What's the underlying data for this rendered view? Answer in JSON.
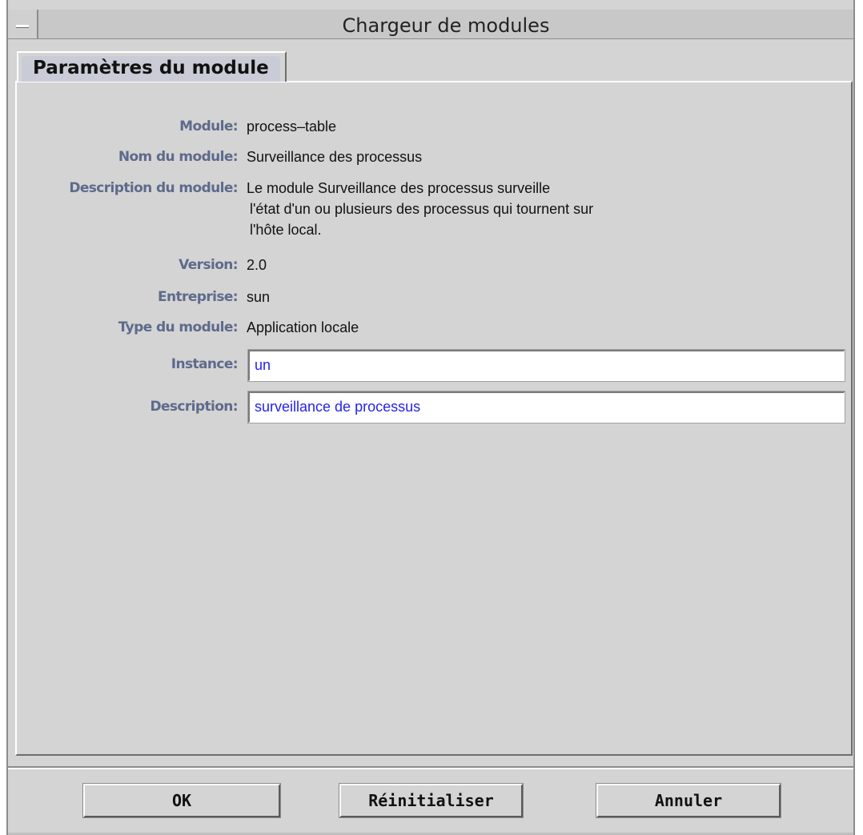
{
  "window": {
    "title": "Chargeur de modules"
  },
  "tabs": [
    {
      "label": "Paramètres du module",
      "selected": true
    }
  ],
  "fields": {
    "module": {
      "label": "Module:",
      "value": "process–table"
    },
    "module_name": {
      "label": "Nom du module:",
      "value": "Surveillance des processus"
    },
    "module_description": {
      "label": "Description du module:",
      "lines": [
        "Le module Surveillance des processus surveille",
        "l'état d'un ou plusieurs des processus qui tournent sur",
        "l'hôte local."
      ]
    },
    "version": {
      "label": "Version:",
      "value": "2.0"
    },
    "company": {
      "label": "Entreprise:",
      "value": "sun"
    },
    "module_type": {
      "label": "Type du module:",
      "value": "Application locale"
    },
    "instance": {
      "label": "Instance:",
      "value": "un"
    },
    "description": {
      "label": "Description:",
      "value": "surveillance de processus"
    }
  },
  "buttons": {
    "ok": "OK",
    "reset": "Réinitialiser",
    "cancel": "Annuler"
  },
  "colors": {
    "label": "#5e6a8c",
    "input_text": "#2323ee",
    "background": "#d4d4d4"
  },
  "icons": {
    "window_menu": "window-menu-icon"
  }
}
